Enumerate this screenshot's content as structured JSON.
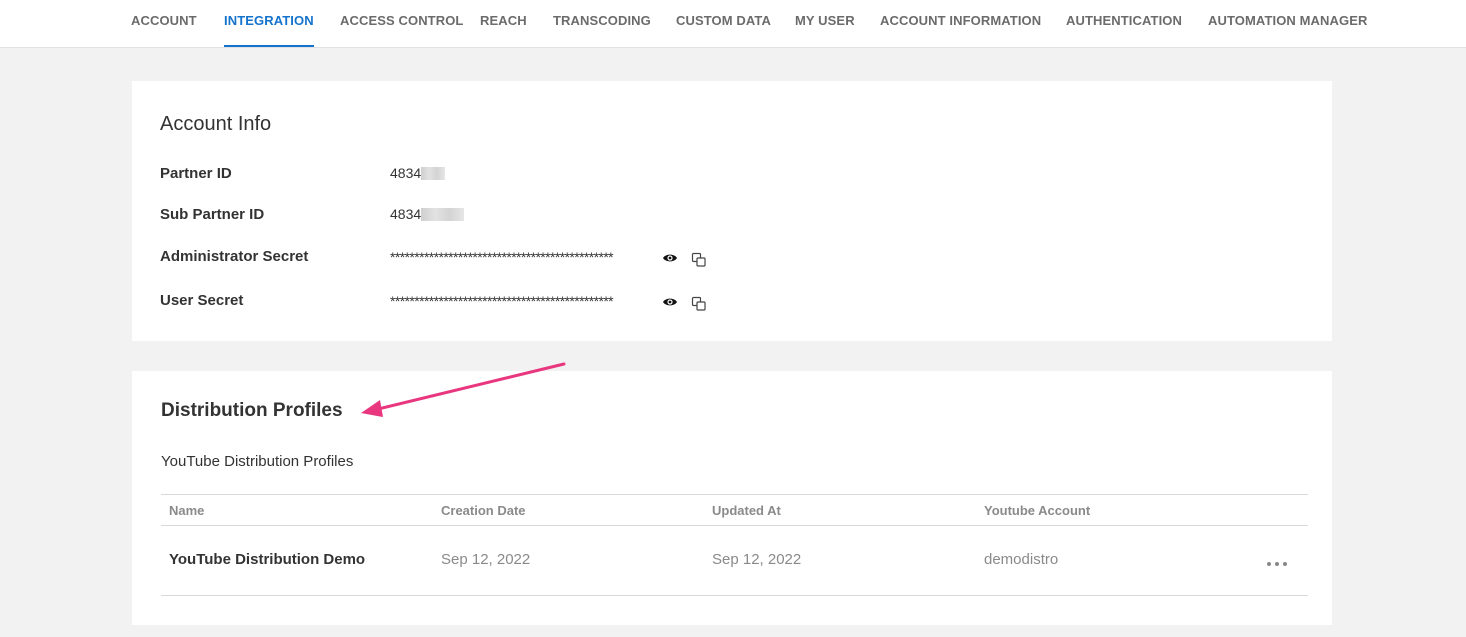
{
  "nav": {
    "tabs": [
      {
        "label": "ACCOUNT"
      },
      {
        "label": "INTEGRATION"
      },
      {
        "label": "ACCESS CONTROL"
      },
      {
        "label": "REACH"
      },
      {
        "label": "TRANSCODING"
      },
      {
        "label": "CUSTOM DATA"
      },
      {
        "label": "MY USER"
      },
      {
        "label": "ACCOUNT INFORMATION"
      },
      {
        "label": "AUTHENTICATION"
      },
      {
        "label": "AUTOMATION MANAGER"
      }
    ],
    "active": "INTEGRATION",
    "accent_color": "#1573cc"
  },
  "account_info": {
    "title": "Account Info",
    "partner_id": {
      "label": "Partner ID",
      "value": "4834"
    },
    "sub_partner_id": {
      "label": "Sub Partner ID",
      "value": "4834"
    },
    "admin_secret": {
      "label": "Administrator Secret",
      "value": "**********************************************"
    },
    "user_secret": {
      "label": "User Secret",
      "value": "**********************************************"
    },
    "icons": [
      "eye-icon",
      "copy-icon"
    ]
  },
  "distribution": {
    "title": "Distribution Profiles",
    "subtitle": "YouTube Distribution Profiles",
    "columns": [
      "Name",
      "Creation Date",
      "Updated At",
      "Youtube Account"
    ],
    "rows": [
      {
        "name": "YouTube Distribution Demo",
        "created": "Sep 12, 2022",
        "updated": "Sep 12, 2022",
        "account": "demodistro"
      }
    ],
    "annotation_arrow_color": "#e8377f"
  }
}
